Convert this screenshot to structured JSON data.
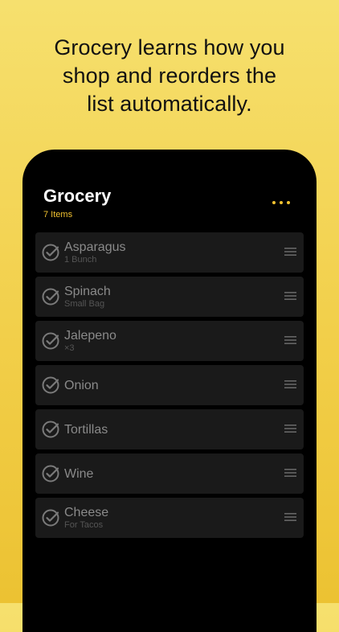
{
  "promo": {
    "headline_lines": [
      "Grocery learns how you",
      "shop and reorders the",
      "list automatically."
    ]
  },
  "app": {
    "title": "Grocery",
    "count_label": "7 Items",
    "more_icon": "ellipsis-icon",
    "check_icon": "check-circle-icon",
    "handle_icon": "drag-handle-icon"
  },
  "colors": {
    "accent": "#f2c230",
    "background_top": "#f6e06e",
    "background_bottom": "#ecc232",
    "phone": "#000000",
    "row": "#1a1a1a",
    "item_text": "#8a8a8a",
    "item_subtext": "#555555"
  },
  "items": [
    {
      "name": "Asparagus",
      "detail": "1 Bunch"
    },
    {
      "name": "Spinach",
      "detail": "Small Bag"
    },
    {
      "name": "Jalepeno",
      "detail": "×3"
    },
    {
      "name": "Onion",
      "detail": ""
    },
    {
      "name": "Tortillas",
      "detail": ""
    },
    {
      "name": "Wine",
      "detail": ""
    },
    {
      "name": "Cheese",
      "detail": "For Tacos"
    }
  ]
}
